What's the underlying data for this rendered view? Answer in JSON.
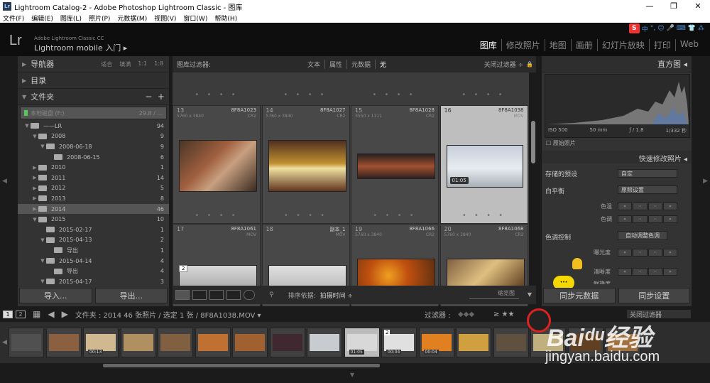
{
  "window": {
    "title": "Lightroom Catalog-2 - Adobe Photoshop Lightroom Classic - 图库",
    "controls": [
      "—",
      "❐",
      "✕"
    ]
  },
  "menu": [
    "文件(F)",
    "编辑(E)",
    "图库(L)",
    "照片(P)",
    "元数据(M)",
    "视图(V)",
    "窗口(W)",
    "帮助(H)"
  ],
  "identity": {
    "logo": "Lr",
    "line1": "Adobe Lightroom Classic CC",
    "line2": "Lightroom mobile 入门  ▸"
  },
  "modules": [
    "图库",
    "修改照片",
    "地图",
    "画册",
    "幻灯片放映",
    "打印",
    "Web"
  ],
  "ime": {
    "s": "S",
    "items": [
      "中",
      "°,",
      "☺",
      "🎤",
      "⌨",
      "👕",
      "⁂"
    ]
  },
  "left": {
    "panels": [
      "导航器",
      "目录",
      "文件夹"
    ],
    "nav_zoom": [
      "适合",
      "填满",
      "1:1",
      "1:8"
    ],
    "volume": {
      "name": "本地磁盘 (F:)",
      "size": "29.8 / ..."
    },
    "folders": [
      {
        "name": "——LR",
        "count": "94",
        "indent": 0,
        "tw": "▼"
      },
      {
        "name": "2008",
        "count": "9",
        "indent": 1,
        "tw": "▼"
      },
      {
        "name": "2008-06-18",
        "count": "9",
        "indent": 2,
        "tw": "▼"
      },
      {
        "name": "2008-06-15",
        "count": "6",
        "indent": 3,
        "tw": ""
      },
      {
        "name": "2010",
        "count": "1",
        "indent": 1,
        "tw": "▶"
      },
      {
        "name": "2011",
        "count": "14",
        "indent": 1,
        "tw": "▶"
      },
      {
        "name": "2012",
        "count": "5",
        "indent": 1,
        "tw": "▶"
      },
      {
        "name": "2013",
        "count": "8",
        "indent": 1,
        "tw": "▶"
      },
      {
        "name": "2014",
        "count": "46",
        "indent": 1,
        "tw": "▶",
        "sel": true
      },
      {
        "name": "2015",
        "count": "10",
        "indent": 1,
        "tw": "▼"
      },
      {
        "name": "2015-02-17",
        "count": "1",
        "indent": 2,
        "tw": ""
      },
      {
        "name": "2015-04-13",
        "count": "2",
        "indent": 2,
        "tw": "▼"
      },
      {
        "name": "导出",
        "count": "1",
        "indent": 3,
        "tw": ""
      },
      {
        "name": "2015-04-14",
        "count": "4",
        "indent": 2,
        "tw": "▼"
      },
      {
        "name": "导出",
        "count": "4",
        "indent": 3,
        "tw": ""
      },
      {
        "name": "2015-04-17",
        "count": "3",
        "indent": 2,
        "tw": "▼"
      }
    ],
    "import_label": "导入...",
    "export_label": "导出..."
  },
  "filterbar": {
    "label": "图库过滤器:",
    "options": [
      "文本",
      "属性",
      "元数据",
      "无"
    ],
    "right": "关闭过滤器 ÷"
  },
  "grid": {
    "cells": [
      {
        "idx": "13",
        "name": "8F8A1023",
        "dim": "5760 x 3840",
        "ext": "CR2"
      },
      {
        "idx": "14",
        "name": "8F8A1027",
        "dim": "5760 x 3840",
        "ext": "CR2"
      },
      {
        "idx": "15",
        "name": "8F8A1028",
        "dim": "3550 x 1111",
        "ext": "CR2"
      },
      {
        "idx": "16",
        "name": "8F8A1038",
        "dim": "",
        "ext": "MOV",
        "duration": "01:05"
      },
      {
        "idx": "17",
        "name": "8F8A1061",
        "dim": "",
        "ext": "MOV",
        "stack": "2"
      },
      {
        "idx": "18",
        "name": "副本_1",
        "dim": "",
        "ext": "MOV"
      },
      {
        "idx": "19",
        "name": "8F8A1066",
        "dim": "5760 x 3840",
        "ext": "CR2"
      },
      {
        "idx": "20",
        "name": "8F8A1068",
        "dim": "5760 x 3840",
        "ext": "CR2"
      }
    ]
  },
  "toolbar": {
    "sort_label": "排序依据:",
    "sort_value": "拍摄时间 ÷",
    "zoom_label": "缩览图"
  },
  "right": {
    "histogram_label": "直方图 ◂",
    "exif": [
      "ISO 500",
      "50 mm",
      "ƒ / 1.8",
      "1/332 秒"
    ],
    "original_photo": "原始照片",
    "quick_develop": "快速修改照片 ◂",
    "saved_preset_label": "存储的预设",
    "saved_preset_value": "自定",
    "wb_label": "白平衡",
    "wb_value": "原照设置",
    "temp_label": "色温",
    "tint_label": "色调",
    "tone_label": "色调控制",
    "auto_tone": "自动调整色调",
    "exposure_label": "曝光度",
    "clarity_label": "清晰度",
    "vibrance_label": "鲜艳度",
    "sync_meta": "同步元数据",
    "sync_settings": "同步设置"
  },
  "filmstrip": {
    "pages": [
      "1",
      "2"
    ],
    "path": "文件夹 : 2014   46 张照片 / 选定 1 张 / 8F8A1038.MOV ▾",
    "filter_label": "过滤器 :",
    "close_filter": "关闭过滤器",
    "thumb_badges": {
      "t3": "00:13",
      "t10": "01:05",
      "t11": "00:04",
      "t12": "00:04",
      "t11s": "2"
    }
  },
  "watermark": {
    "brand": "Baiᵈᵘ经验",
    "url": "jingyan.baidu.com"
  },
  "colors": {
    "accent": "#dddddd",
    "ime_red": "#ee3333"
  }
}
